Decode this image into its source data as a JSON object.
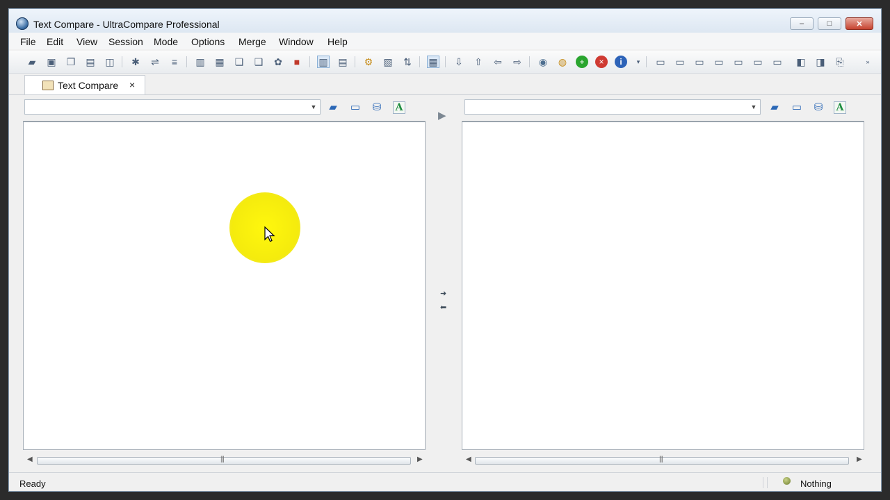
{
  "window": {
    "title": "Text Compare - UltraCompare Professional",
    "controls": {
      "minimize": "–",
      "maximize": "□",
      "close": "✕"
    }
  },
  "menu": [
    "File",
    "Edit",
    "View",
    "Session",
    "Mode",
    "Options",
    "Merge",
    "Window",
    "Help"
  ],
  "toolbar": {
    "icons": [
      "open-folder",
      "save",
      "copy",
      "print",
      "preview",
      "star",
      "align",
      "equal",
      "doc",
      "grid",
      "layers",
      "layers2",
      "flow",
      "red-block",
      "split-columns",
      "merge-layout",
      "gear",
      "sheet",
      "swap",
      "pane-select",
      "arrow-down",
      "arrow-up",
      "arrow-left",
      "arrow-right",
      "globe",
      "stop",
      "add-green",
      "close-red",
      "info",
      "more"
    ]
  },
  "tab": {
    "label": "Text Compare",
    "close": "×"
  },
  "left_pane": {
    "path_value": "",
    "dropdown": "▼",
    "font_button": "A"
  },
  "right_pane": {
    "path_value": "",
    "dropdown": "▼",
    "font_button": "A"
  },
  "middle": {
    "play": "▶",
    "copy_right": "➜",
    "copy_left": "⬅"
  },
  "status": {
    "left": "Ready",
    "right": "Nothing"
  },
  "colors": {
    "highlight": "#fff700",
    "accent": "#2a67b6"
  }
}
